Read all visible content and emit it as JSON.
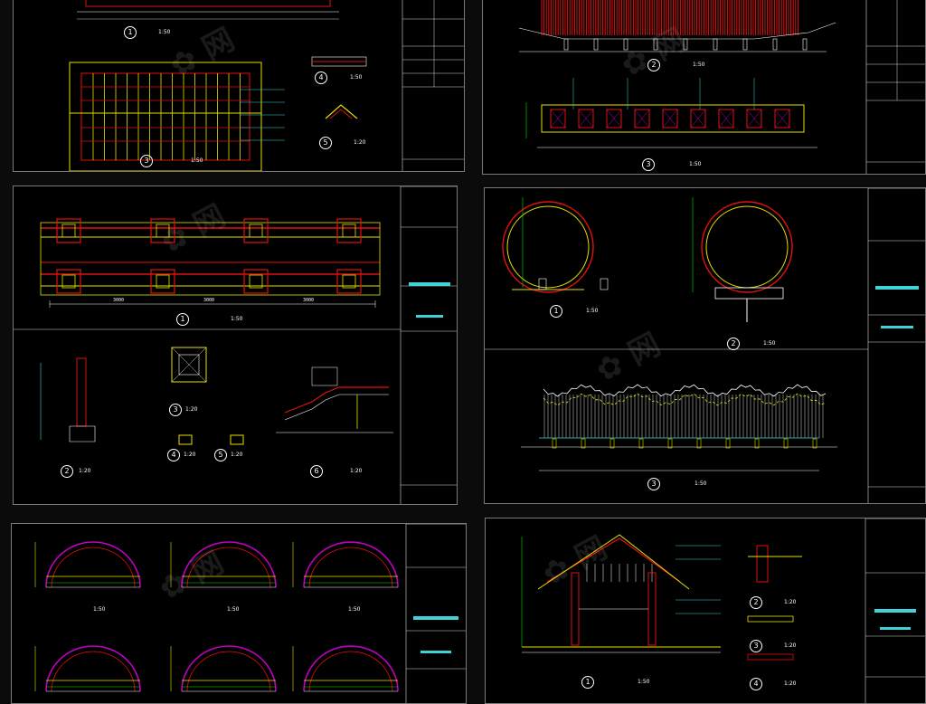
{
  "viewer": {
    "background": "#0b0b0b"
  },
  "colors": {
    "cyan": "#3fd3d8",
    "yellow": "#e6e000",
    "green": "#00e000",
    "red": "#e01010",
    "white": "#ffffff",
    "magenta": "#c000c0"
  },
  "sheets": [
    {
      "id": "A",
      "labels": {
        "d1": "1",
        "d3": "3",
        "d4": "4",
        "d5": "5",
        "s1": "1:50",
        "s3": "1:50",
        "s4": "1:50",
        "s5": "1:20"
      }
    },
    {
      "id": "B",
      "labels": {
        "d2": "2",
        "d3": "3",
        "s2": "1:50",
        "s3": "1:50"
      }
    },
    {
      "id": "C",
      "labels": {
        "d1": "1",
        "d2": "2",
        "d3": "3",
        "d4": "4",
        "d5": "5",
        "d6": "6",
        "s1": "1:50",
        "s2": "1:20",
        "s3": "1:20",
        "s4": "1:20",
        "s5": "1:20",
        "s6": "1:20",
        "dim1": "3000",
        "dim2": "3000",
        "dim3": "3000"
      }
    },
    {
      "id": "D",
      "labels": {
        "d1": "1",
        "d2": "2",
        "d3": "3",
        "s1": "1:50",
        "s2": "1:50",
        "s3": "1:50"
      }
    },
    {
      "id": "E",
      "labels": {
        "a1": "1:50",
        "a2": "1:50",
        "a3": "1:50"
      }
    },
    {
      "id": "F",
      "labels": {
        "d1": "1",
        "d2": "2",
        "d3": "3",
        "d4": "4",
        "s1": "1:50",
        "s2": "1:20",
        "s3": "1:20",
        "s4": "1:20"
      }
    }
  ]
}
